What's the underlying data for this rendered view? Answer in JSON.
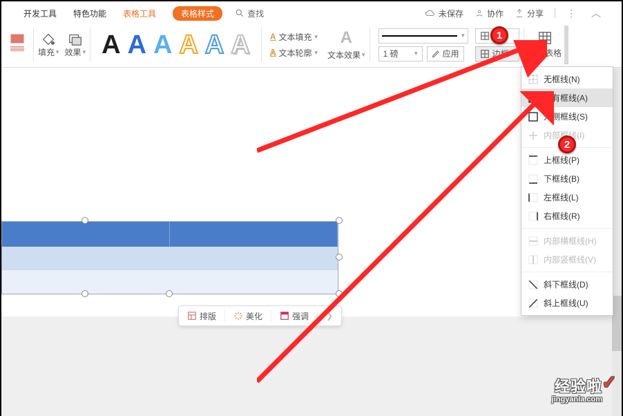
{
  "menubar": {
    "items": [
      "开发工具",
      "特色功能",
      "表格工具",
      "表格样式"
    ],
    "search": "查找",
    "right": {
      "unsaved": "未保存",
      "collab": "协作",
      "share": "分享"
    }
  },
  "ribbon": {
    "fill": "填充",
    "effect": "效果",
    "text_fill": "文本填充",
    "text_outline": "文本轮廓",
    "text_effect": "文本效果",
    "points": "1 磅",
    "apply": "应用",
    "border": "边框",
    "clear": "清除表格"
  },
  "floatbar": {
    "layout": "排版",
    "beautify": "美化",
    "emphasis": "强调"
  },
  "dropdown": {
    "items": [
      "无框线(N)",
      "所有框线(A)",
      "外侧框线(S)",
      "内部框线(I)",
      "上框线(P)",
      "下框线(B)",
      "左框线(L)",
      "右框线(R)",
      "内部横框线(H)",
      "内部竖框线(V)",
      "斜下框线(D)",
      "斜上框线(U)"
    ],
    "disabled": [
      3,
      8,
      9
    ]
  },
  "annotations": {
    "b1": "1",
    "b2": "2"
  },
  "watermark": {
    "title": "经验啦",
    "url": "jingyanla.com"
  }
}
